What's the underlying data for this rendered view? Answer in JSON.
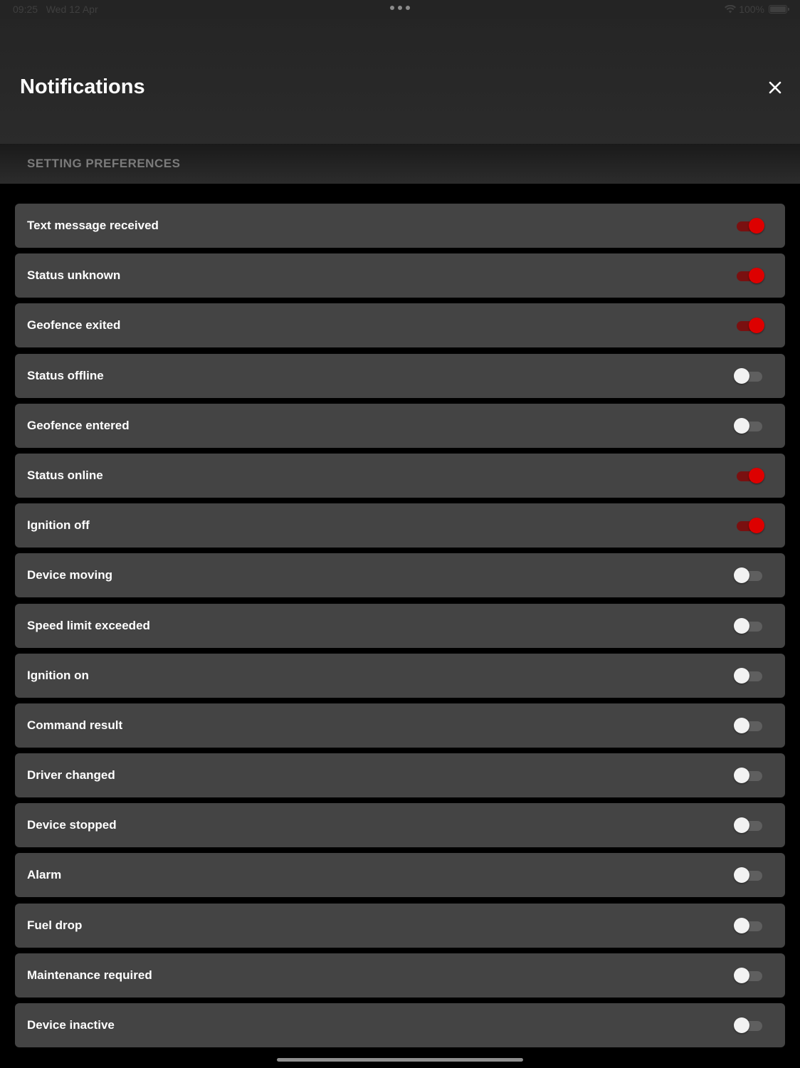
{
  "status_bar": {
    "time": "09:25",
    "date": "Wed 12 Apr",
    "battery": "100%",
    "icons": [
      "wifi-icon",
      "battery-icon",
      "more-dots-icon"
    ]
  },
  "header": {
    "title": "Notifications",
    "close_icon": "close-icon"
  },
  "section": {
    "title": "SETTING PREFERENCES"
  },
  "colors": {
    "toggle_on": "#dd0000",
    "toggle_off": "#f2f2f2",
    "row_background": "#444444"
  },
  "preferences": [
    {
      "label": "Text message received",
      "enabled": true
    },
    {
      "label": "Status unknown",
      "enabled": true
    },
    {
      "label": "Geofence exited",
      "enabled": true
    },
    {
      "label": "Status offline",
      "enabled": false
    },
    {
      "label": "Geofence entered",
      "enabled": false
    },
    {
      "label": "Status online",
      "enabled": true
    },
    {
      "label": "Ignition off",
      "enabled": true
    },
    {
      "label": "Device moving",
      "enabled": false
    },
    {
      "label": "Speed limit exceeded",
      "enabled": false
    },
    {
      "label": "Ignition on",
      "enabled": false
    },
    {
      "label": "Command result",
      "enabled": false
    },
    {
      "label": "Driver changed",
      "enabled": false
    },
    {
      "label": "Device stopped",
      "enabled": false
    },
    {
      "label": "Alarm",
      "enabled": false
    },
    {
      "label": "Fuel drop",
      "enabled": false
    },
    {
      "label": "Maintenance required",
      "enabled": false
    },
    {
      "label": "Device inactive",
      "enabled": false
    }
  ]
}
